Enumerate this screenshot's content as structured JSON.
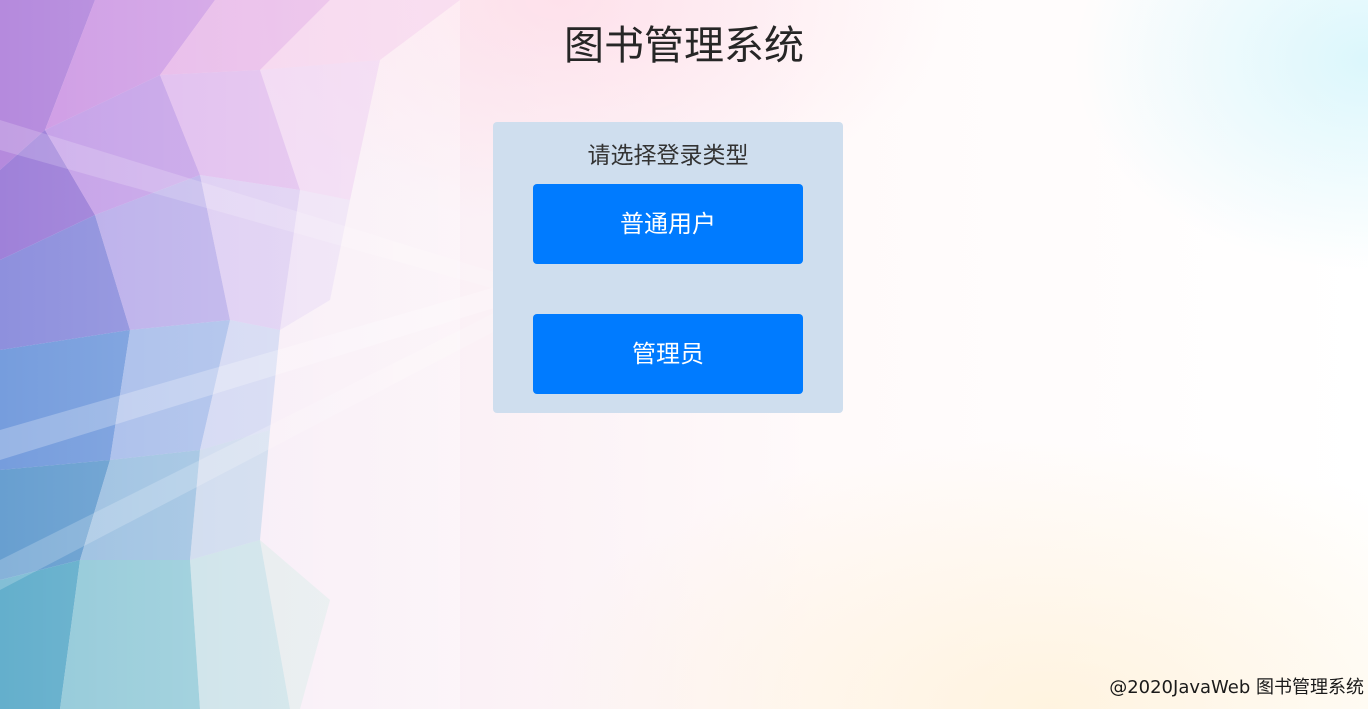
{
  "page": {
    "title": "图书管理系统"
  },
  "login_panel": {
    "prompt": "请选择登录类型",
    "user_button_label": "普通用户",
    "admin_button_label": "管理员"
  },
  "footer": {
    "credit": "@2020JavaWeb 图书管理系统"
  },
  "colors": {
    "panel_background": "#cfdeee",
    "button_primary": "#007bff",
    "button_text": "#ffffff",
    "title_text": "#262626"
  }
}
